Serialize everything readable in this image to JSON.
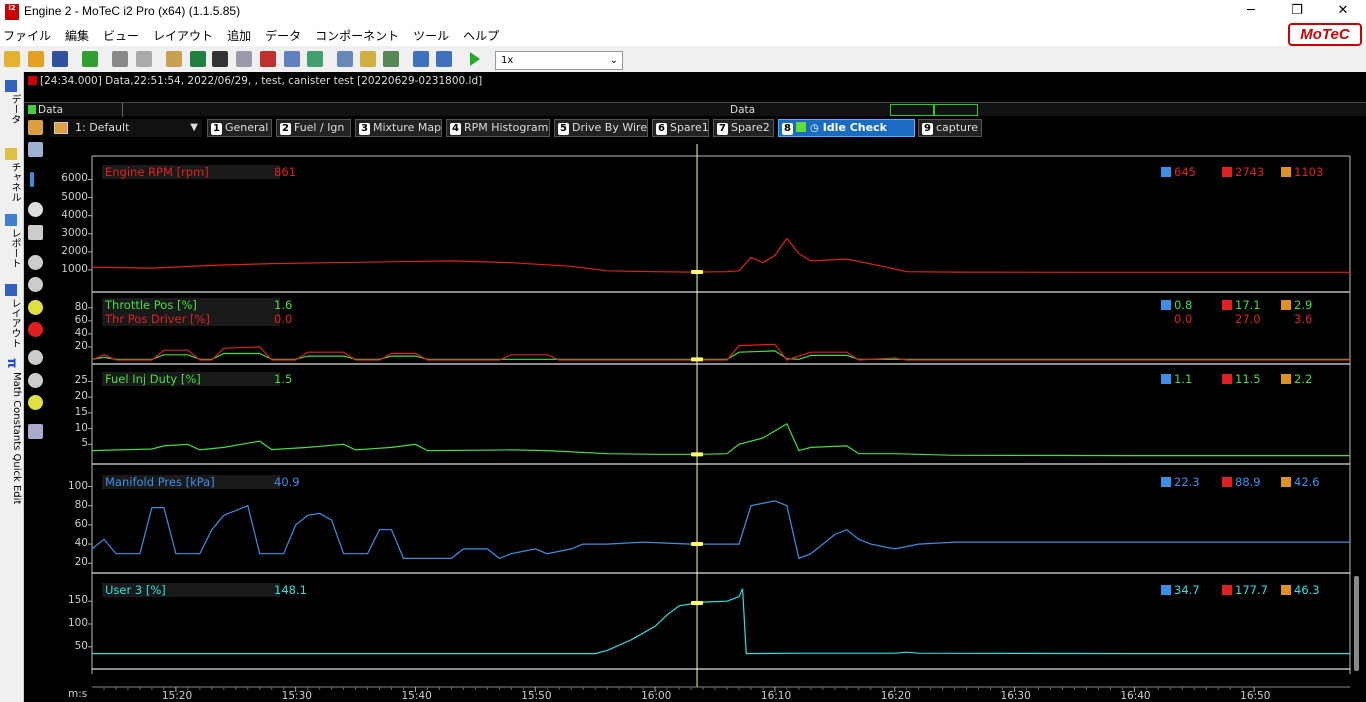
{
  "window": {
    "title": "Engine 2 - MoTeC i2 Pro (x64) (1.1.5.85)",
    "app_icon_text": "i2",
    "minimize": "─",
    "maximize": "❐",
    "close": "✕"
  },
  "menu": [
    "ファイル",
    "編集",
    "ビュー",
    "レイアウト",
    "追加",
    "データ",
    "コンポーネント",
    "ツール",
    "ヘルプ"
  ],
  "brand": "MoTeC",
  "toolbar": {
    "zoom_value": "1x"
  },
  "info_line": "[24:34.000] Data,22:51:54, 2022/06/29, , test, canister test [20220629-0231800.ld]",
  "sidebar_tabs": [
    "データ",
    "チャネル",
    "レポート",
    "レイアウト",
    "Math Constants Quick Edit"
  ],
  "data_bar": {
    "left_label": "Data",
    "center_label": "Data"
  },
  "layout_select": "1: Default",
  "worksheet_tabs": [
    {
      "num": "1",
      "label": "General"
    },
    {
      "num": "2",
      "label": "Fuel / Ign"
    },
    {
      "num": "3",
      "label": "Mixture Map"
    },
    {
      "num": "4",
      "label": "RPM Histogram"
    },
    {
      "num": "5",
      "label": "Drive By Wire"
    },
    {
      "num": "6",
      "label": "Spare1"
    },
    {
      "num": "7",
      "label": "Spare2"
    },
    {
      "num": "8",
      "label": "Idle Check",
      "active": true
    },
    {
      "num": "9",
      "label": "capture"
    }
  ],
  "colors": {
    "rpm": "#e02020",
    "throttle": "#40e040",
    "fuel": "#40e040",
    "manifold": "#3a8fe8",
    "user3": "#30e0e0",
    "cursor": "#ffff66"
  },
  "chart_data": {
    "type": "line",
    "x_axis_label": "m:s",
    "x_ticks": [
      "15:20",
      "15:30",
      "15:40",
      "15:50",
      "16:00",
      "16:10",
      "16:20",
      "16:30",
      "16:40",
      "16:50"
    ],
    "x_range_s": [
      913,
      1018
    ],
    "cursor_time_s": 963.5,
    "panes": [
      {
        "series": [
          {
            "name": "Engine RPM [rpm]",
            "value": "861",
            "color_key": "rpm",
            "min": "645",
            "max": "2743",
            "avg": "1103",
            "points": [
              [
                913,
                1150
              ],
              [
                918,
                1100
              ],
              [
                923,
                1250
              ],
              [
                928,
                1350
              ],
              [
                933,
                1400
              ],
              [
                938,
                1450
              ],
              [
                943,
                1500
              ],
              [
                948,
                1400
              ],
              [
                953,
                1200
              ],
              [
                956,
                950
              ],
              [
                960,
                900
              ],
              [
                963,
                880
              ],
              [
                966,
                900
              ],
              [
                967,
                950
              ],
              [
                968,
                1700
              ],
              [
                969,
                1400
              ],
              [
                970,
                1800
              ],
              [
                971,
                2743
              ],
              [
                972,
                1900
              ],
              [
                973,
                1500
              ],
              [
                976,
                1600
              ],
              [
                979,
                1200
              ],
              [
                981,
                900
              ],
              [
                985,
                880
              ],
              [
                995,
                870
              ],
              [
                1005,
                870
              ],
              [
                1018,
                870
              ]
            ]
          }
        ],
        "yticks": [
          "6000",
          "5000",
          "4000",
          "3000",
          "2000",
          "1000"
        ],
        "y_range": [
          0,
          6800
        ]
      },
      {
        "series": [
          {
            "name": "Throttle Pos [%]",
            "value": "1.6",
            "color_key": "throttle",
            "min": "0.8",
            "max": "17.1",
            "avg": "2.9",
            "points": [
              [
                913,
                1
              ],
              [
                914,
                4
              ],
              [
                915,
                1
              ],
              [
                918,
                1
              ],
              [
                919,
                8
              ],
              [
                921,
                8
              ],
              [
                922,
                1
              ],
              [
                923,
                1
              ],
              [
                924,
                10
              ],
              [
                927,
                10
              ],
              [
                928,
                1
              ],
              [
                930,
                1
              ],
              [
                931,
                6
              ],
              [
                934,
                6
              ],
              [
                935,
                1
              ],
              [
                937,
                1
              ],
              [
                938,
                6
              ],
              [
                940,
                6
              ],
              [
                941,
                1
              ],
              [
                947,
                1
              ],
              [
                948,
                1
              ],
              [
                956,
                1
              ],
              [
                966,
                1
              ],
              [
                967,
                12
              ],
              [
                970,
                14
              ],
              [
                971,
                2
              ],
              [
                972,
                1
              ],
              [
                973,
                7
              ],
              [
                976,
                7
              ],
              [
                977,
                1
              ],
              [
                980,
                1
              ],
              [
                981,
                1
              ],
              [
                1018,
                1
              ]
            ]
          },
          {
            "name": "Thr Pos Driver [%]",
            "value": "0.0",
            "color_key": "rpm",
            "min": "0.0",
            "max": "27.0",
            "avg": "3.6",
            "points": [
              [
                913,
                0
              ],
              [
                914,
                8
              ],
              [
                915,
                0
              ],
              [
                918,
                0
              ],
              [
                919,
                15
              ],
              [
                921,
                15
              ],
              [
                922,
                0
              ],
              [
                923,
                0
              ],
              [
                924,
                18
              ],
              [
                927,
                20
              ],
              [
                928,
                0
              ],
              [
                930,
                0
              ],
              [
                931,
                12
              ],
              [
                934,
                12
              ],
              [
                935,
                0
              ],
              [
                937,
                0
              ],
              [
                938,
                10
              ],
              [
                940,
                10
              ],
              [
                941,
                0
              ],
              [
                947,
                0
              ],
              [
                948,
                8
              ],
              [
                951,
                8
              ],
              [
                952,
                0
              ],
              [
                966,
                0
              ],
              [
                967,
                22
              ],
              [
                970,
                24
              ],
              [
                971,
                0
              ],
              [
                973,
                12
              ],
              [
                976,
                12
              ],
              [
                977,
                0
              ],
              [
                980,
                3
              ],
              [
                981,
                0
              ],
              [
                1018,
                0
              ]
            ]
          }
        ],
        "yticks": [
          "80",
          "60",
          "40",
          "20"
        ],
        "y_range": [
          0,
          95
        ]
      },
      {
        "series": [
          {
            "name": "Fuel Inj Duty [%]",
            "value": "1.5",
            "color_key": "fuel",
            "min": "1.1",
            "max": "11.5",
            "avg": "2.2",
            "points": [
              [
                913,
                3
              ],
              [
                918,
                3.5
              ],
              [
                919,
                4.5
              ],
              [
                921,
                5
              ],
              [
                922,
                3.2
              ],
              [
                924,
                4
              ],
              [
                927,
                6
              ],
              [
                928,
                3.3
              ],
              [
                931,
                4
              ],
              [
                934,
                5
              ],
              [
                935,
                3.2
              ],
              [
                938,
                4
              ],
              [
                940,
                5
              ],
              [
                941,
                3
              ],
              [
                948,
                3.2
              ],
              [
                951,
                3
              ],
              [
                956,
                2
              ],
              [
                960,
                1.8
              ],
              [
                964,
                1.8
              ],
              [
                966,
                2
              ],
              [
                967,
                5
              ],
              [
                969,
                7
              ],
              [
                971,
                11.5
              ],
              [
                972,
                3
              ],
              [
                973,
                4
              ],
              [
                976,
                4.5
              ],
              [
                977,
                2
              ],
              [
                980,
                2
              ],
              [
                985,
                1.5
              ],
              [
                1000,
                1.4
              ],
              [
                1018,
                1.4
              ]
            ]
          }
        ],
        "yticks": [
          "25",
          "20",
          "15",
          "10",
          "5"
        ],
        "y_range": [
          0,
          28
        ]
      },
      {
        "series": [
          {
            "name": "Manifold Pres [kPa]",
            "value": "40.9",
            "color_key": "manifold",
            "min": "22.3",
            "max": "88.9",
            "avg": "42.6",
            "points": [
              [
                913,
                35
              ],
              [
                914,
                45
              ],
              [
                915,
                30
              ],
              [
                917,
                30
              ],
              [
                918,
                78
              ],
              [
                919,
                78
              ],
              [
                920,
                30
              ],
              [
                922,
                30
              ],
              [
                923,
                55
              ],
              [
                924,
                70
              ],
              [
                925,
                75
              ],
              [
                926,
                80
              ],
              [
                927,
                30
              ],
              [
                929,
                30
              ],
              [
                930,
                60
              ],
              [
                931,
                70
              ],
              [
                932,
                72
              ],
              [
                933,
                65
              ],
              [
                934,
                30
              ],
              [
                936,
                30
              ],
              [
                937,
                55
              ],
              [
                938,
                55
              ],
              [
                939,
                25
              ],
              [
                943,
                25
              ],
              [
                944,
                35
              ],
              [
                946,
                35
              ],
              [
                947,
                25
              ],
              [
                948,
                30
              ],
              [
                950,
                35
              ],
              [
                951,
                30
              ],
              [
                953,
                35
              ],
              [
                954,
                40
              ],
              [
                956,
                40
              ],
              [
                959,
                42
              ],
              [
                963,
                40
              ],
              [
                967,
                40
              ],
              [
                968,
                80
              ],
              [
                970,
                85
              ],
              [
                971,
                80
              ],
              [
                972,
                25
              ],
              [
                973,
                30
              ],
              [
                975,
                50
              ],
              [
                976,
                55
              ],
              [
                977,
                45
              ],
              [
                978,
                40
              ],
              [
                980,
                35
              ],
              [
                982,
                40
              ],
              [
                985,
                42
              ],
              [
                1000,
                42
              ],
              [
                1018,
                42
              ]
            ]
          }
        ],
        "yticks": [
          "100",
          "80",
          "60",
          "40",
          "20"
        ],
        "y_range": [
          14,
          112
        ]
      },
      {
        "series": [
          {
            "name": "User 3 [%]",
            "value": "148.1",
            "color_key": "user3",
            "min": "34.7",
            "max": "177.7",
            "avg": "46.3",
            "points": [
              [
                913,
                35
              ],
              [
                930,
                35
              ],
              [
                950,
                35
              ],
              [
                955,
                35
              ],
              [
                956,
                42
              ],
              [
                958,
                65
              ],
              [
                960,
                95
              ],
              [
                961,
                120
              ],
              [
                962,
                140
              ],
              [
                964,
                148
              ],
              [
                966,
                150
              ],
              [
                967,
                160
              ],
              [
                967.3,
                177.7
              ],
              [
                967.6,
                35
              ],
              [
                972,
                36
              ],
              [
                975,
                36
              ],
              [
                980,
                36
              ],
              [
                981,
                38
              ],
              [
                982,
                36
              ],
              [
                1000,
                35
              ],
              [
                1018,
                35
              ]
            ]
          }
        ],
        "yticks": [
          "150",
          "100",
          "50"
        ],
        "y_range": [
          10,
          190
        ]
      }
    ]
  }
}
